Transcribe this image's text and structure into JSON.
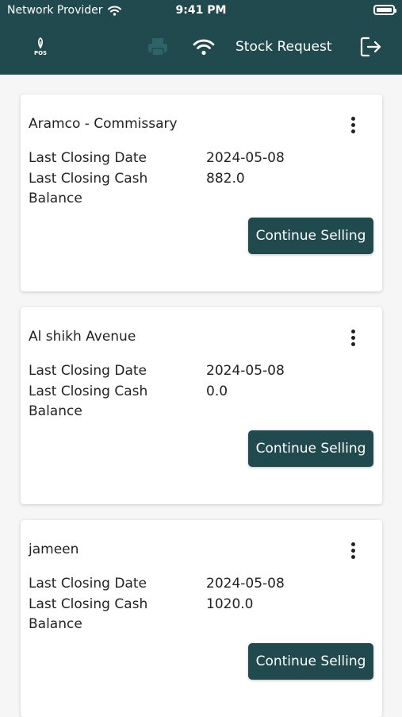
{
  "status_bar": {
    "carrier": "Network Provider",
    "time": "9:41 PM"
  },
  "header": {
    "logo_text": "POS",
    "stock_request_label": "Stock Request",
    "icons": [
      "pos-logo-icon",
      "printer-icon",
      "wifi-icon",
      "logout-icon"
    ],
    "brand_color": "#204a4e"
  },
  "stores": [
    {
      "name": "Aramco - Commissary",
      "date_label": "Last Closing Date",
      "date_value": "2024-05-08",
      "cash_label_line1": "Last Closing Cash",
      "cash_label_line2": "Balance",
      "cash_value": "882.0",
      "button_label": "Continue Selling"
    },
    {
      "name": "Al shikh Avenue",
      "date_label": "Last Closing Date",
      "date_value": "2024-05-08",
      "cash_label_line1": "Last Closing Cash",
      "cash_label_line2": "Balance",
      "cash_value": "0.0",
      "button_label": "Continue Selling"
    },
    {
      "name": "jameen",
      "date_label": "Last Closing Date",
      "date_value": "2024-05-08",
      "cash_label_line1": "Last Closing Cash",
      "cash_label_line2": "Balance",
      "cash_value": "1020.0",
      "button_label": "Continue Selling"
    }
  ]
}
